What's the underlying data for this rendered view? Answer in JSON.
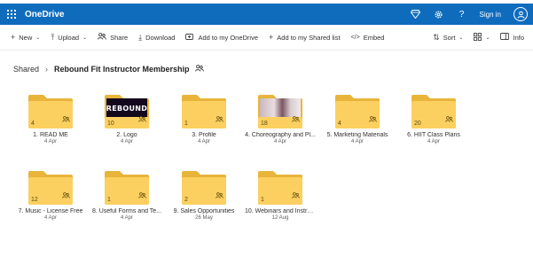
{
  "topbar": {
    "app_name": "OneDrive",
    "icons": [
      "waffle-icon",
      "diamond-icon",
      "settings-icon",
      "help-icon",
      "avatar-icon"
    ],
    "help_glyph": "?",
    "signin_label": "Sign in",
    "color": "#0f6cbd"
  },
  "commands": {
    "new": "New",
    "upload": "Upload",
    "share": "Share",
    "download": "Download",
    "add_to_onedrive": "Add to my OneDrive",
    "add_to_shared_list": "Add to my Shared list",
    "embed": "Embed",
    "sort": "Sort",
    "info": "Info"
  },
  "breadcrumb": {
    "root": "Shared",
    "current": "Rebound Fit Instructor Membership"
  },
  "folders": [
    {
      "count": "4",
      "name": "1. READ ME",
      "date": "4 Apr",
      "thumb": "none"
    },
    {
      "count": "10",
      "name": "2. Logo",
      "date": "4 Apr",
      "thumb": "logo",
      "thumb_text": "REBOUND"
    },
    {
      "count": "1",
      "name": "3. Profile",
      "date": "4 Apr",
      "thumb": "none"
    },
    {
      "count": "18",
      "name": "4. Choreography and Pl...",
      "date": "4 Apr",
      "thumb": "photo"
    },
    {
      "count": "4",
      "name": "5. Marketing Materials",
      "date": "4 Apr",
      "thumb": "none"
    },
    {
      "count": "20",
      "name": "6. HIIT Class Plans",
      "date": "4 Apr",
      "thumb": "none"
    },
    {
      "count": "12",
      "name": "7. Music - License Free",
      "date": "4 Apr",
      "thumb": "none"
    },
    {
      "count": "1",
      "name": "8. Useful Forms and Te...",
      "date": "4 Apr",
      "thumb": "none"
    },
    {
      "count": "2",
      "name": "9. Sales Opportunities",
      "date": "26 May",
      "thumb": "none"
    },
    {
      "count": "1",
      "name": "10. Webinars and Instru...",
      "date": "12 Aug",
      "thumb": "none"
    }
  ],
  "colors": {
    "folder_back": "#e8b43a",
    "folder_front": "#fcd060",
    "accent": "#0f6cbd"
  }
}
